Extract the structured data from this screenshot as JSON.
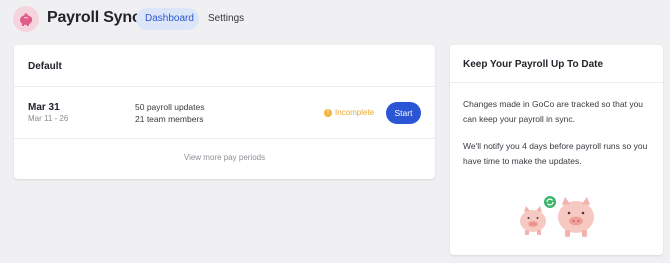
{
  "app": {
    "title": "Payroll Sync",
    "logo_icon": "piggy-bank-icon",
    "logo_color": "#f6d4de"
  },
  "nav": {
    "tabs": [
      {
        "label": "Dashboard",
        "active": true
      },
      {
        "label": "Settings",
        "active": false
      }
    ]
  },
  "payroll": {
    "title": "Default",
    "period": {
      "date": "Mar 31",
      "range": "Mar 11 - 26",
      "updates": "50 payroll updates",
      "members": "21 team members",
      "status": "Incomplete",
      "status_color": "#e8a93a",
      "action_label": "Start",
      "action_color": "#2a56d6"
    },
    "more_link": "View more pay periods"
  },
  "info": {
    "title": "Keep Your Payroll Up To Date",
    "paragraph1": "Changes made in GoCo are tracked so that you can keep your payroll in sync.",
    "paragraph2": "We'll notify you 4 days before payroll runs so you have time to make the updates.",
    "illustration_icon": "piggy-banks-sync-illustration"
  }
}
